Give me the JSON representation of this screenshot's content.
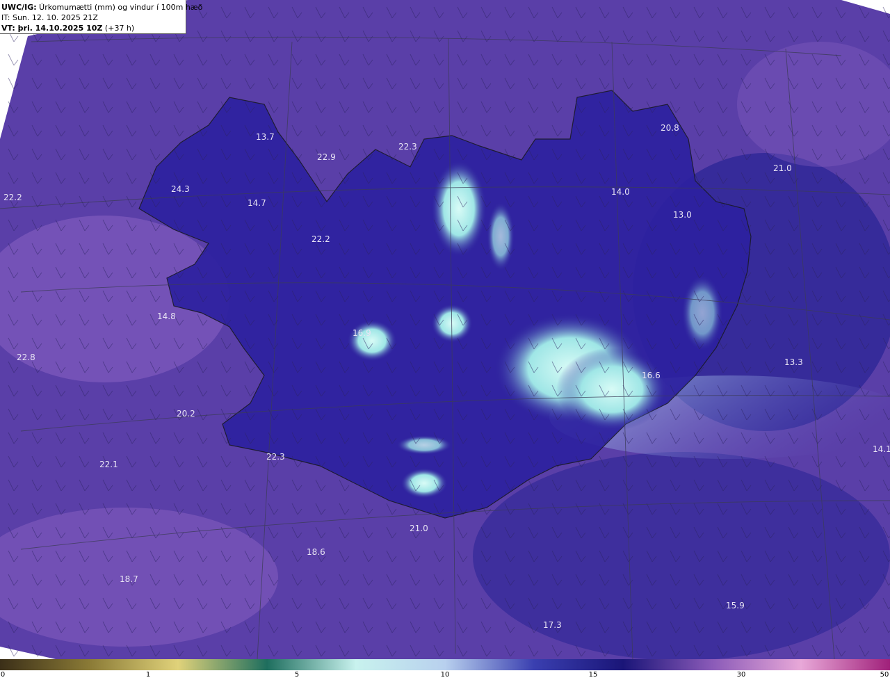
{
  "title": {
    "model_prefix": "UWC/IG:",
    "description": " Úrkomumætti (mm) og vindur í 100m hæð",
    "init_time": "IT: Sun. 12. 10. 2025 21Z",
    "valid_prefix": "VT: þri. 14.10.2025 10Z",
    "valid_suffix": " (+37 h)"
  },
  "colors": {
    "background_precip": "#5a3fa8",
    "land_dark": "#2a1f9a",
    "high_precip": "#c8f4ee",
    "coastline": "#1a1a2a",
    "grid_line": "#3c3c58"
  },
  "value_labels": [
    "22.2",
    "13.7",
    "22.9",
    "22.3",
    "20.8",
    "21.0",
    "24.3",
    "14.7",
    "14.0",
    "13.0",
    "22.2",
    "14.8",
    "16.9",
    "22.8",
    "13.3",
    "16.6",
    "20.2",
    "22.1",
    "22.3",
    "14.1",
    "21.0",
    "18.6",
    "18.7",
    "15.9",
    "17.3"
  ],
  "colorbar": {
    "ticks": [
      "0",
      "1",
      "5",
      "10",
      "15",
      "30",
      "50"
    ],
    "stops": [
      "#3b2f18",
      "#8a7a36",
      "#e0d27a",
      "#1e6e5e",
      "#c8f2ee",
      "#b8d0ee",
      "#3a3fb0",
      "#1a1578",
      "#8a5ab8",
      "#e8a8d8",
      "#a0207a"
    ]
  }
}
